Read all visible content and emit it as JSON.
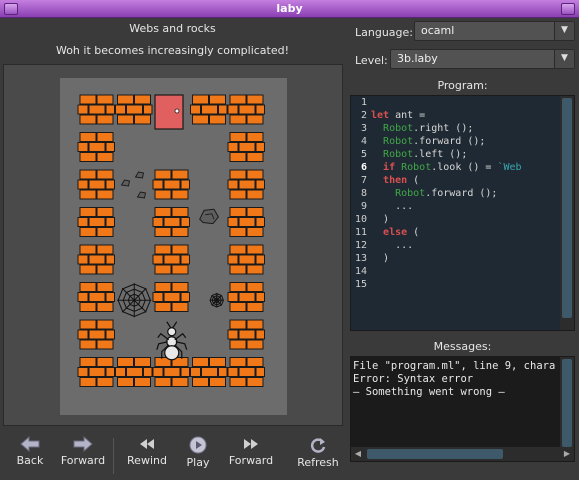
{
  "window": {
    "title": "laby"
  },
  "level": {
    "title": "Webs and rocks",
    "description": "Woh it becomes increasingly complicated!"
  },
  "language": {
    "label": "Language:",
    "value": "ocaml"
  },
  "level_select": {
    "label": "Level:",
    "value": "3b.laby"
  },
  "program": {
    "label": "Program:",
    "line_numbers": [
      "1",
      "2",
      "3",
      "4",
      "5",
      "6",
      "7",
      "8",
      "9",
      "10",
      "11",
      "12",
      "13",
      "14",
      "15"
    ],
    "active_line": "6",
    "lines": [
      "let ant =",
      "  Robot.right ();",
      "  Robot.forward ();",
      "  Robot.left ();",
      "  if Robot.look () = `Web",
      "  then (",
      "    Robot.forward ();",
      "    ...",
      "  )",
      "  else (",
      "    ...",
      "  )"
    ]
  },
  "messages": {
    "label": "Messages:",
    "lines": [
      "File \"program.ml\", line 9, chara",
      "Error: Syntax error",
      "— Something went wrong —"
    ]
  },
  "toolbar": {
    "back": "Back",
    "forward": "Forward",
    "rewind": "Rewind",
    "play": "Play",
    "step_forward": "Forward",
    "refresh": "Refresh"
  },
  "colors": {
    "titlebar": "#9b52c2",
    "brick": "#f07818",
    "door": "#e06060",
    "floor": "#6c6c6c"
  },
  "board": {
    "icons": [
      "brick-wall-icon",
      "exit-door-icon",
      "rock-icon",
      "web-icon",
      "ant-icon"
    ]
  }
}
